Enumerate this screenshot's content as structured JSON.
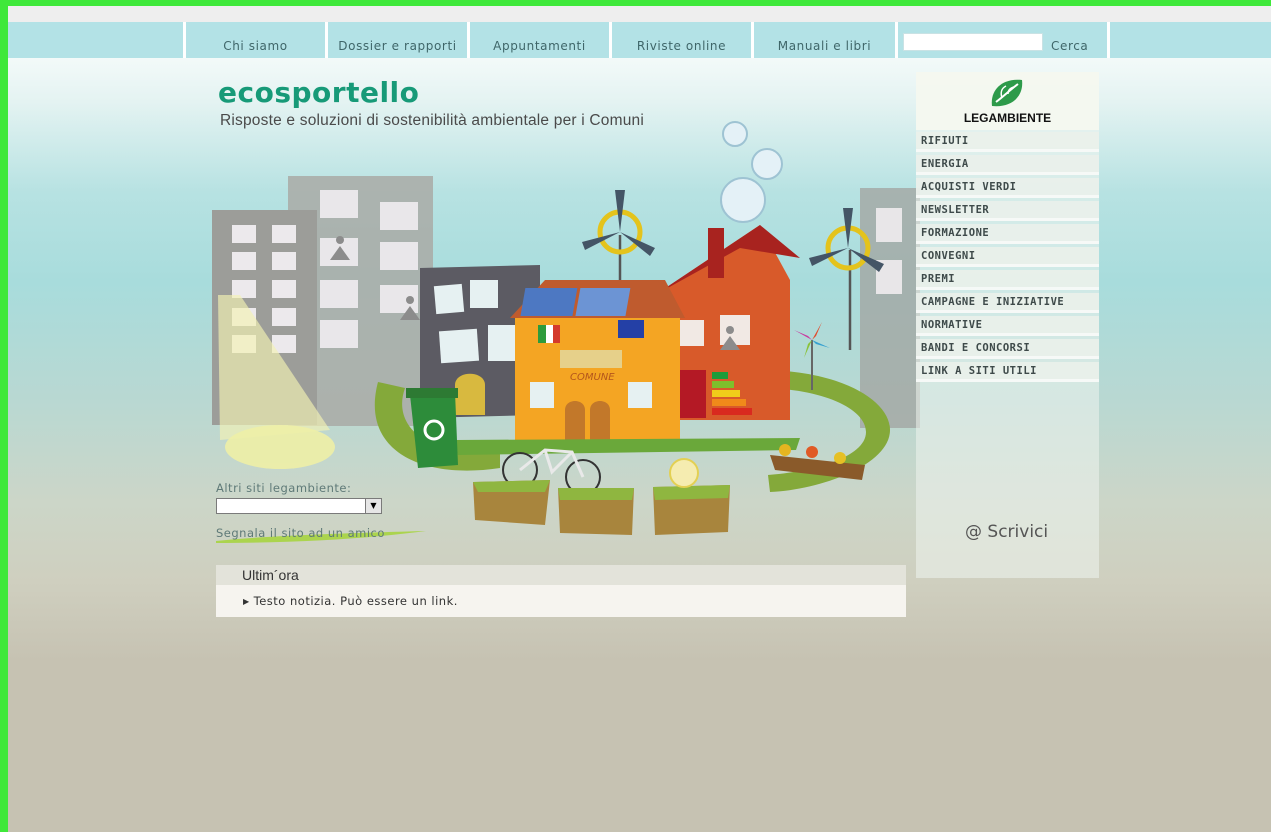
{
  "nav": {
    "items": [
      "Chi siamo",
      "Dossier e rapporti",
      "Appuntamenti",
      "Riviste online",
      "Manuali e libri"
    ],
    "search_value": "",
    "search_button": "Cerca"
  },
  "header": {
    "logo": "ecosportello",
    "tagline": "Risposte e soluzioni di sostenibilità ambientale per i Comuni"
  },
  "illustration": {
    "building_label": "COMUNE"
  },
  "sidebar": {
    "brand": "LEGAMBIENTE",
    "menu": [
      "RIFIUTI",
      "ENERGIA",
      "ACQUISTI VERDI",
      "NEWSLETTER",
      "FORMAZIONE",
      "CONVEGNI",
      "PREMI",
      "CAMPAGNE E INIZIATIVE",
      "NORMATIVE",
      "BANDI E CONCORSI",
      "LINK A SITI UTILI"
    ],
    "contact": "@ Scrivici"
  },
  "left": {
    "altri_label": "Altri siti legambiente:",
    "select_value": "",
    "segnala": "Segnala il sito ad un amico"
  },
  "news": {
    "title": "Ultim´ora",
    "items": [
      "Testo notizia. Può essere un link."
    ]
  },
  "colors": {
    "accent": "#179a78",
    "nav_bg": "#b3e2e6",
    "frame": "#3fe83a"
  }
}
